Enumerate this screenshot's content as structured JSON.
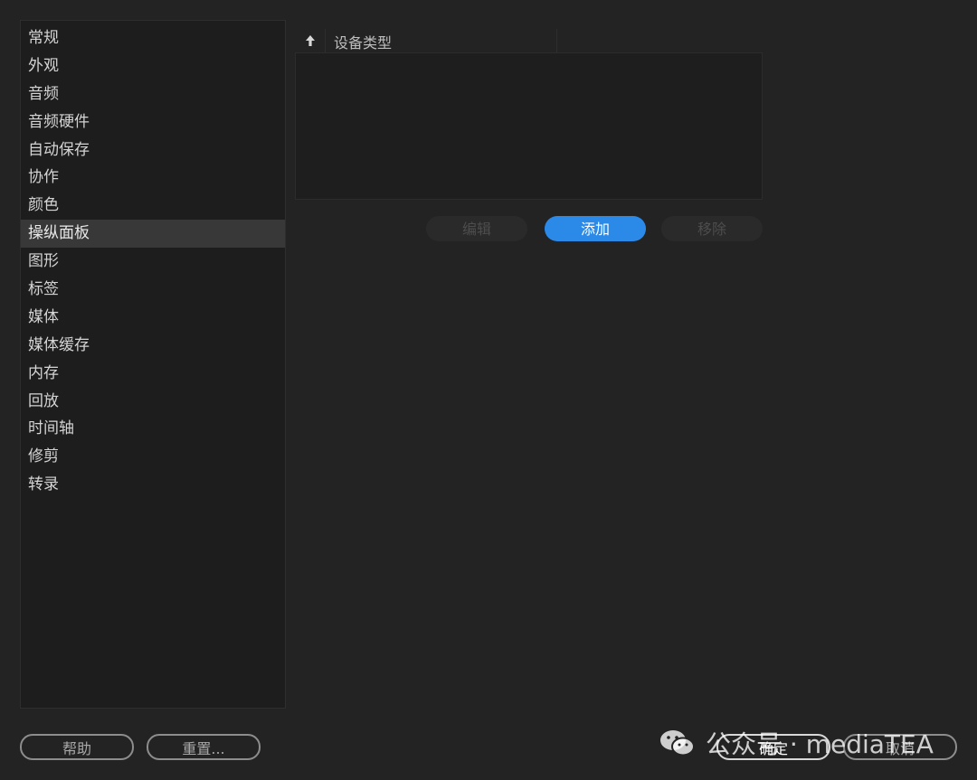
{
  "sidebar": {
    "items": [
      {
        "label": "常规"
      },
      {
        "label": "外观"
      },
      {
        "label": "音频"
      },
      {
        "label": "音频硬件"
      },
      {
        "label": "自动保存"
      },
      {
        "label": "协作"
      },
      {
        "label": "颜色"
      },
      {
        "label": "操纵面板",
        "selected": true
      },
      {
        "label": "图形"
      },
      {
        "label": "标签"
      },
      {
        "label": "媒体"
      },
      {
        "label": "媒体缓存"
      },
      {
        "label": "内存"
      },
      {
        "label": "回放"
      },
      {
        "label": "时间轴"
      },
      {
        "label": "修剪"
      },
      {
        "label": "转录"
      }
    ]
  },
  "device_table": {
    "sort_icon": "arrow-up-icon",
    "column_header": "设备类型",
    "rows": []
  },
  "actions": {
    "edit_label": "编辑",
    "add_label": "添加",
    "remove_label": "移除"
  },
  "footer": {
    "help_label": "帮助",
    "reset_label": "重置...",
    "ok_label": "确定",
    "cancel_label": "取消"
  },
  "watermark": {
    "icon": "wechat-icon",
    "text": "公众号 · mediaTEA"
  },
  "colors": {
    "accent": "#2b8ae8",
    "background": "#232323",
    "panel": "#1d1d1d",
    "selected_row": "#383838"
  }
}
